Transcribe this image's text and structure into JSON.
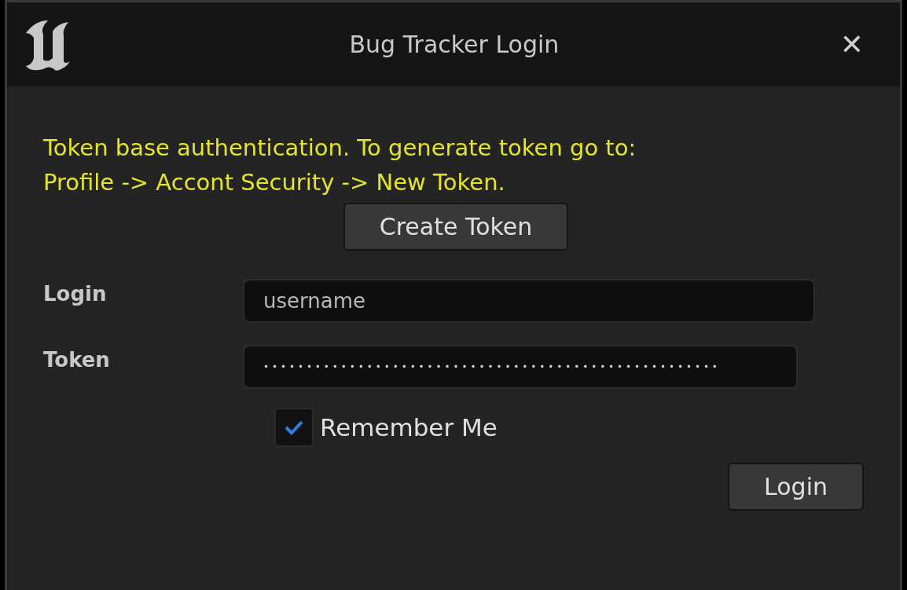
{
  "window": {
    "title": "Bug Tracker Login",
    "close": "✕"
  },
  "notice": [
    "Token base authentication. To generate token go to:",
    "Profile -> Accont Security -> New Token."
  ],
  "create_button": "Create Token",
  "fields": [
    {
      "label": "Login",
      "kind": "text",
      "value": "username"
    },
    {
      "label": "Token",
      "kind": "password",
      "value": "•••••••••••••••••••••••••••••••••••••••••••••••••••••"
    }
  ],
  "remember": {
    "label": "Remember Me",
    "checked": true
  },
  "login_button": "Login"
}
